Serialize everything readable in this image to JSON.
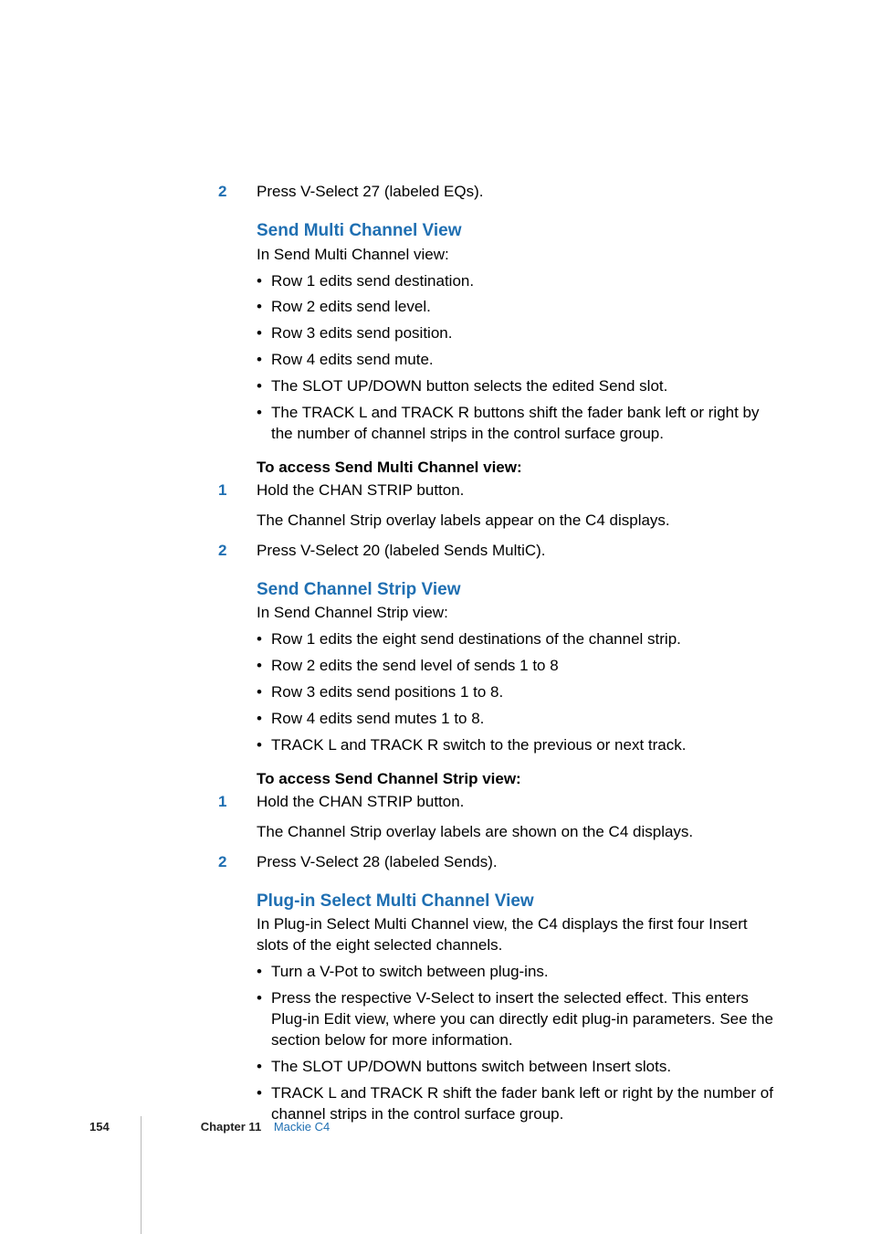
{
  "step_top": {
    "num": "2",
    "text": "Press V-Select 27 (labeled EQs)."
  },
  "section1": {
    "heading": "Send Multi Channel View",
    "intro": "In Send Multi Channel view:",
    "bullets": [
      "Row 1 edits send destination.",
      "Row 2 edits send level.",
      "Row 3 edits send position.",
      "Row 4 edits send mute.",
      "The SLOT UP/DOWN button selects the edited Send slot.",
      "The TRACK L and TRACK R buttons shift the fader bank left or right by the number of channel strips in the control surface group."
    ],
    "procedure_heading": "To access Send Multi Channel view:",
    "steps": [
      {
        "num": "1",
        "text": "Hold the CHAN STRIP button."
      },
      {
        "para": "The Channel Strip overlay labels appear on the C4 displays."
      },
      {
        "num": "2",
        "text": "Press V-Select 20 (labeled Sends MultiC)."
      }
    ]
  },
  "section2": {
    "heading": "Send Channel Strip View",
    "intro": "In Send Channel Strip view:",
    "bullets": [
      "Row 1 edits the eight send destinations of the channel strip.",
      "Row 2 edits the send level of sends 1 to 8",
      "Row 3 edits send positions 1 to 8.",
      "Row 4 edits send mutes 1 to 8.",
      "TRACK L and TRACK R switch to the previous or next track."
    ],
    "procedure_heading": "To access Send Channel Strip view:",
    "steps": [
      {
        "num": "1",
        "text": "Hold the CHAN STRIP button."
      },
      {
        "para": "The Channel Strip overlay labels are shown on the C4 displays."
      },
      {
        "num": "2",
        "text": "Press V-Select 28 (labeled Sends)."
      }
    ]
  },
  "section3": {
    "heading": "Plug-in Select Multi Channel View",
    "intro": "In Plug-in Select Multi Channel view, the C4 displays the first four Insert slots of the eight selected channels.",
    "bullets": [
      "Turn a V-Pot to switch between plug-ins.",
      "Press the respective V-Select to insert the selected effect. This enters Plug-in Edit view, where you can directly edit plug-in parameters. See the section below for more information.",
      "The SLOT UP/DOWN buttons switch between Insert slots.",
      "TRACK L and TRACK R shift the fader bank left or right by the number of channel strips in the control surface group."
    ]
  },
  "footer": {
    "page": "154",
    "chapter_label": "Chapter 11",
    "chapter_title": "Mackie C4"
  }
}
